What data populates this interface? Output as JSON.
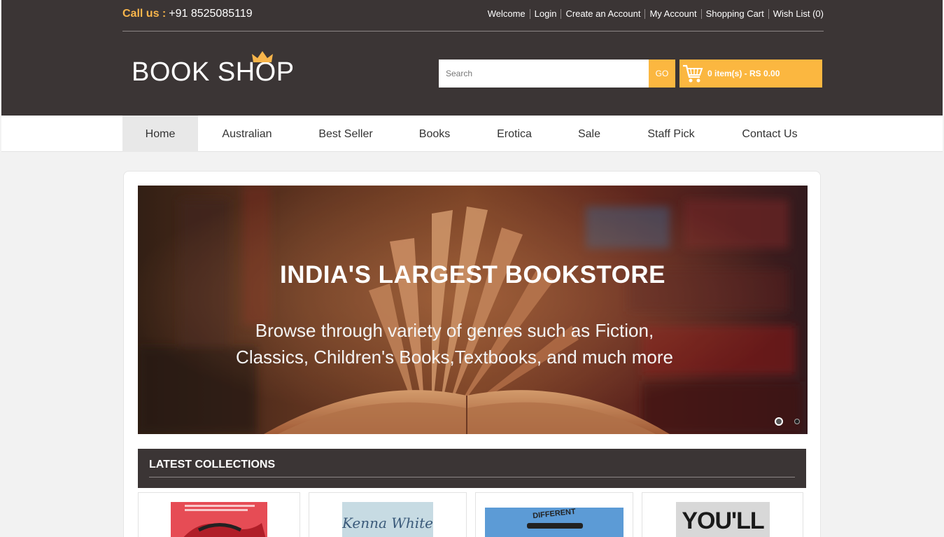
{
  "header": {
    "call_label": "Call us :",
    "phone": "+91 8525085119",
    "links": [
      "Welcome",
      "Login",
      "Create an Account",
      "My Account",
      "Shopping Cart",
      "Wish List (0)"
    ],
    "logo_text": "BOOK SHOP",
    "search_placeholder": "Search",
    "go_label": "GO",
    "cart_text": "0 item(s) - RS 0.00"
  },
  "nav": {
    "items": [
      "Home",
      "Australian",
      "Best Seller",
      "Books",
      "Erotica",
      "Sale",
      "Staff Pick",
      "Contact Us"
    ],
    "active": "Home"
  },
  "slider": {
    "title": "INDIA'S LARGEST BOOKSTORE",
    "subtitle_line1": "Browse through variety of genres such as Fiction,",
    "subtitle_line2": "Classics, Children's Books,Textbooks, and much more",
    "active_slide": 1,
    "slide_count": 2
  },
  "collections": {
    "heading": "LATEST COLLECTIONS",
    "covers": [
      {
        "label": "",
        "color": "#e64c55"
      },
      {
        "label": "Kenna White",
        "color": "#c7dbe3"
      },
      {
        "label": "DIFFERENT",
        "color": "#5c9bd6"
      },
      {
        "label": "YOU'LL",
        "color": "#d8d8d8"
      }
    ]
  },
  "colors": {
    "header_bg": "#3b3535",
    "accent": "#fbb740",
    "nav_active_bg": "#e8e8e8"
  }
}
